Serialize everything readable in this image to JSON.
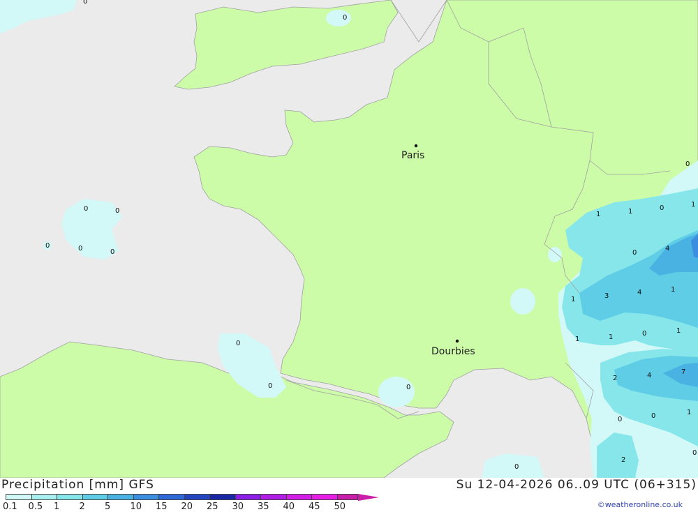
{
  "map": {
    "cities": [
      {
        "name": "Paris",
        "id": "paris"
      },
      {
        "name": "Dourbies",
        "id": "dourbies"
      }
    ],
    "precip_labels": [
      "0",
      "0",
      "0",
      "0",
      "0",
      "0",
      "0",
      "0",
      "0",
      "0",
      "0",
      "0",
      "1",
      "1",
      "0",
      "1",
      "0",
      "4",
      "1",
      "3",
      "4",
      "1",
      "1",
      "1",
      "0",
      "1",
      "2",
      "4",
      "7",
      "0",
      "0",
      "1",
      "2",
      "0",
      "0",
      "0"
    ]
  },
  "footer": {
    "title_left": "Precipitation [mm] GFS",
    "title_right": "Su 12-04-2026 06..09 UTC (06+315)",
    "credit": "©weatheronline.co.uk"
  },
  "legend": {
    "ticks": [
      "0.1",
      "0.5",
      "1",
      "2",
      "5",
      "10",
      "15",
      "20",
      "25",
      "30",
      "35",
      "40",
      "45",
      "50"
    ],
    "colors": [
      "#d2f8f8",
      "#a8f0f0",
      "#86e6ea",
      "#5fcde6",
      "#4ab2e2",
      "#3b8ee0",
      "#2f69d8",
      "#2445c0",
      "#1a26a6",
      "#8c1ee6",
      "#b01ee6",
      "#d21ee6",
      "#e61ee6",
      "#c81eaa"
    ]
  }
}
